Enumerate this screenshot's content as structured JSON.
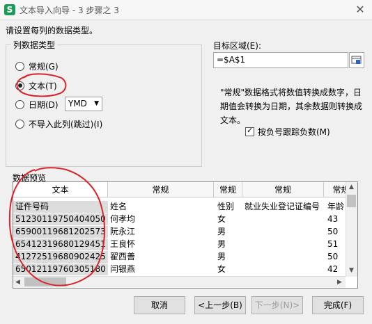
{
  "window": {
    "app_icon": "S",
    "title": "文本导入向导 - 3 步骤之 3",
    "close": "✕"
  },
  "instruction": "请设置每列的数据类型。",
  "column_type": {
    "legend": "列数据类型",
    "options": [
      "常规(G)",
      "文本(T)",
      "日期(D)",
      "不导入此列(跳过)(I)"
    ],
    "selected": "文本(T)",
    "date_format": "YMD"
  },
  "target": {
    "label": "目标区域(E):",
    "value": "=$A$1"
  },
  "description": "\"常规\"数据格式将数值转换成数字，日期值会转换为日期，其余数据则转换成文本。",
  "negative_checkbox": {
    "label": "按负号跟踪负数(M)",
    "checked": true
  },
  "preview": {
    "label": "数据预览",
    "headers": [
      "文本",
      "常规",
      "常规",
      "常规",
      "常规"
    ],
    "rows": [
      [
        "证件号码",
        "姓名",
        "性别",
        "就业失业登记证编号",
        "年龄"
      ],
      [
        "51230119750404050",
        "何孝均",
        "女",
        "",
        "43"
      ],
      [
        "65900119681202573",
        "阮永江",
        "男",
        "",
        "50"
      ],
      [
        "65412319680129451",
        "王良怀",
        "男",
        "",
        "51"
      ],
      [
        "41272519680902425",
        "翟西善",
        "男",
        "",
        "50"
      ],
      [
        "65012119760305180",
        "闫银燕",
        "女",
        "",
        "42"
      ]
    ]
  },
  "buttons": {
    "cancel": "取消",
    "back": "<上一步(B)",
    "next": "下一步(N)>",
    "finish": "完成(F)"
  }
}
